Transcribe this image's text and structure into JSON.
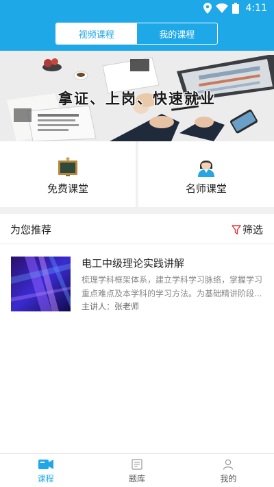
{
  "status": {
    "time": "4:11"
  },
  "header": {
    "tabs": [
      {
        "label": "视频课程",
        "active": true
      },
      {
        "label": "我的课程",
        "active": false
      }
    ]
  },
  "banner": {
    "slogan": "拿证、上岗、快速就业"
  },
  "entries": [
    {
      "label": "免费课堂",
      "icon": "blackboard-icon"
    },
    {
      "label": "名师课堂",
      "icon": "teacher-icon"
    }
  ],
  "recommend": {
    "title": "为您推荐",
    "filter_label": "筛选",
    "filter_icon": "filter-icon"
  },
  "course": {
    "title": "电工中级理论实践讲解",
    "description": "梳理学科框架体系，建立学科学习脉络，掌握学习重点难点及本学科的学习方法。为基础精讲阶段...",
    "teacher": "主讲人：张老师"
  },
  "tabbar": [
    {
      "label": "课程",
      "icon": "video-course-icon",
      "active": true
    },
    {
      "label": "题库",
      "icon": "question-bank-icon",
      "active": false
    },
    {
      "label": "我的",
      "icon": "profile-icon",
      "active": false
    }
  ],
  "colors": {
    "accent": "#1fa8e8",
    "divider": "#f1f1f1",
    "filter": "#e0353d"
  }
}
